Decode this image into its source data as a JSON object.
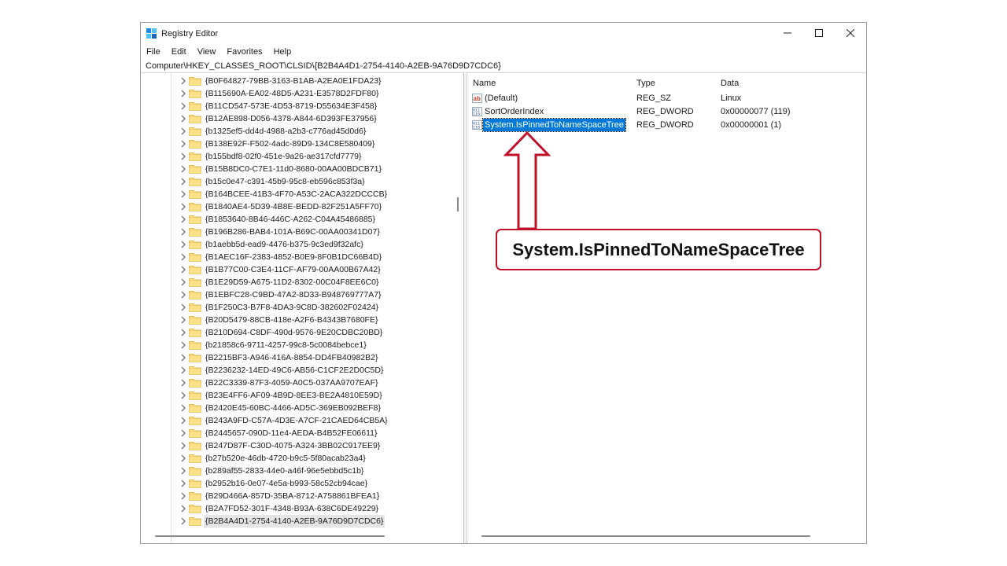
{
  "window": {
    "title": "Registry Editor",
    "minimize_glyph": "—",
    "maximize_glyph": "☐",
    "close_glyph": "✕"
  },
  "menu": [
    "File",
    "Edit",
    "View",
    "Favorites",
    "Help"
  ],
  "address": "Computer\\HKEY_CLASSES_ROOT\\CLSID\\{B2B4A4D1-2754-4140-A2EB-9A76D9D7CDC6}",
  "tree": {
    "items": [
      "{B0F64827-79BB-3163-B1AB-A2EA0E1FDA23}",
      "{B115690A-EA02-48D5-A231-E3578D2FDF80}",
      "{B11CD547-573E-4D53-8719-D55634E3F458}",
      "{B12AE898-D056-4378-A844-6D393FE37956}",
      "{b1325ef5-dd4d-4988-a2b3-c776ad45d0d6}",
      "{B138E92F-F502-4adc-89D9-134C8E580409}",
      "{b155bdf8-02f0-451e-9a26-ae317cfd7779}",
      "{B15B8DC0-C7E1-11d0-8680-00AA00BDCB71}",
      "{b15c0e47-c391-45b9-95c8-eb596c853f3a}",
      "{B164BCEE-41B3-4F70-A53C-2ACA322DCCCB}",
      "{B1840AE4-5D39-4B8E-BEDD-82F251A5FF70}",
      "{B1853640-8B46-446C-A262-C04A45486885}",
      "{B196B286-BAB4-101A-B69C-00AA00341D07}",
      "{b1aebb5d-ead9-4476-b375-9c3ed9f32afc}",
      "{B1AEC16F-2383-4852-B0E9-8F0B1DC66B4D}",
      "{B1B77C00-C3E4-11CF-AF79-00AA00B67A42}",
      "{B1E29D59-A675-11D2-8302-00C04F8EE6C0}",
      "{B1EBFC28-C9BD-47A2-8D33-B948769777A7}",
      "{B1F250C3-B7F8-4DA3-9C8D-382602F02424}",
      "{B20D5479-88CB-418e-A2F6-B4343B7680FE}",
      "{B210D694-C8DF-490d-9576-9E20CDBC20BD}",
      "{b21858c6-9711-4257-99c8-5c0084bebce1}",
      "{B2215BF3-A946-416A-8854-DD4FB40982B2}",
      "{B2236232-14ED-49C6-AB56-C1CF2E2D0C5D}",
      "{B22C3339-87F3-4059-A0C5-037AA9707EAF}",
      "{B23E4FF6-AF09-4B9D-8EE3-BE2A4810E59D}",
      "{B2420E45-60BC-4466-AD5C-369EB092BEF8}",
      "{B243A9FD-C57A-4D3E-A7CF-21CAED64CB5A}",
      "{B2445657-090D-11e4-AEDA-B4B52FE06611}",
      "{B247D87F-C30D-4075-A324-3BB02C917EE9}",
      "{b27b520e-46db-4720-b9c5-5f80acab23a4}",
      "{b289af55-2833-44e0-a46f-96e5ebbd5c1b}",
      "{b2952b16-0e07-4e5a-b993-58c52cb94cae}",
      "{B29D466A-857D-35BA-8712-A758861BFEA1}",
      "{B2A7FD52-301F-4348-B93A-638C6DE49229}",
      "{B2B4A4D1-2754-4140-A2EB-9A76D9D7CDC6}"
    ],
    "selected_index": 35
  },
  "values": {
    "columns": {
      "name": "Name",
      "type": "Type",
      "data": "Data"
    },
    "rows": [
      {
        "icon": "string-value-icon",
        "name": "(Default)",
        "type": "REG_SZ",
        "data": "Linux"
      },
      {
        "icon": "binary-value-icon",
        "name": "SortOrderIndex",
        "type": "REG_DWORD",
        "data": "0x00000077 (119)"
      },
      {
        "icon": "binary-value-icon",
        "name": "System.IsPinnedToNameSpaceTree",
        "type": "REG_DWORD",
        "data": "0x00000001 (1)"
      }
    ],
    "selected_index": 2
  },
  "callout": {
    "text": "System.IsPinnedToNameSpaceTree",
    "accent_color": "#c0102a"
  }
}
